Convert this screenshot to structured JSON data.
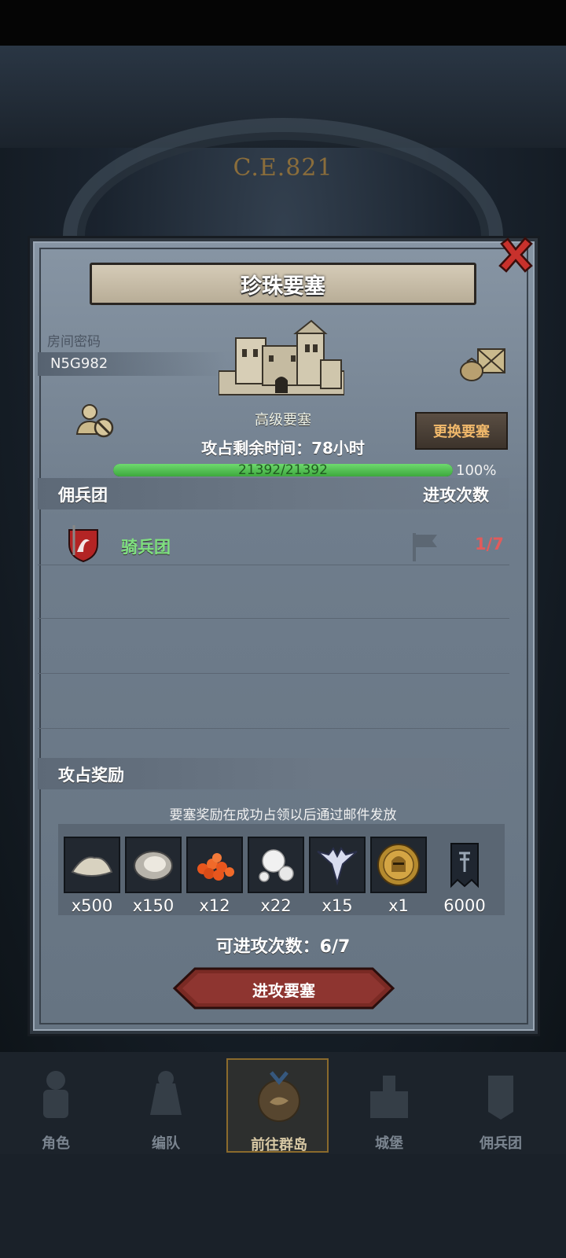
{
  "background": {
    "era_label": "C.E.821"
  },
  "dialog": {
    "title": "珍珠要塞",
    "room_label": "房间密码",
    "room_code": "N5G982",
    "fort_level": "高级要塞",
    "time_remaining": "攻占剩余时间：78小时",
    "change_fort_button": "更换要塞",
    "hp": {
      "text": "21392/21392",
      "percent_label": "100%",
      "fraction": 1.0
    },
    "mercenary_section": {
      "title": "佣兵团",
      "attacks_header": "进攻次数"
    },
    "mercenaries": [
      {
        "name": "骑兵团",
        "attacks": "1/7"
      }
    ],
    "reward_section": {
      "title": "攻占奖励",
      "note": "要塞奖励在成功占领以后通过邮件发放"
    },
    "rewards": [
      {
        "icon": "sand-pile-icon",
        "qty": "x500"
      },
      {
        "icon": "oyster-icon",
        "qty": "x150"
      },
      {
        "icon": "roe-icon",
        "qty": "x12"
      },
      {
        "icon": "pearl-icon",
        "qty": "x22"
      },
      {
        "icon": "wing-emblem-icon",
        "qty": "x15"
      },
      {
        "icon": "knight-coin-icon",
        "qty": "x1"
      },
      {
        "icon": "banner-icon",
        "qty": "6000"
      }
    ],
    "attack_count": "可进攻次数：6/7",
    "attack_button": "进攻要塞"
  },
  "nav": {
    "items": [
      {
        "label": "角色",
        "icon": "character-icon"
      },
      {
        "label": "编队",
        "icon": "formation-icon"
      },
      {
        "label": "前往群岛",
        "icon": "islands-icon",
        "active": true
      },
      {
        "label": "城堡",
        "icon": "castle-icon"
      },
      {
        "label": "佣兵团",
        "icon": "mercenary-icon"
      }
    ]
  },
  "colors": {
    "accent_gold": "#f1b96b",
    "hp_green": "#4cc44c",
    "merc_green": "#7fe07f",
    "attack_red": "#e25b5b"
  }
}
